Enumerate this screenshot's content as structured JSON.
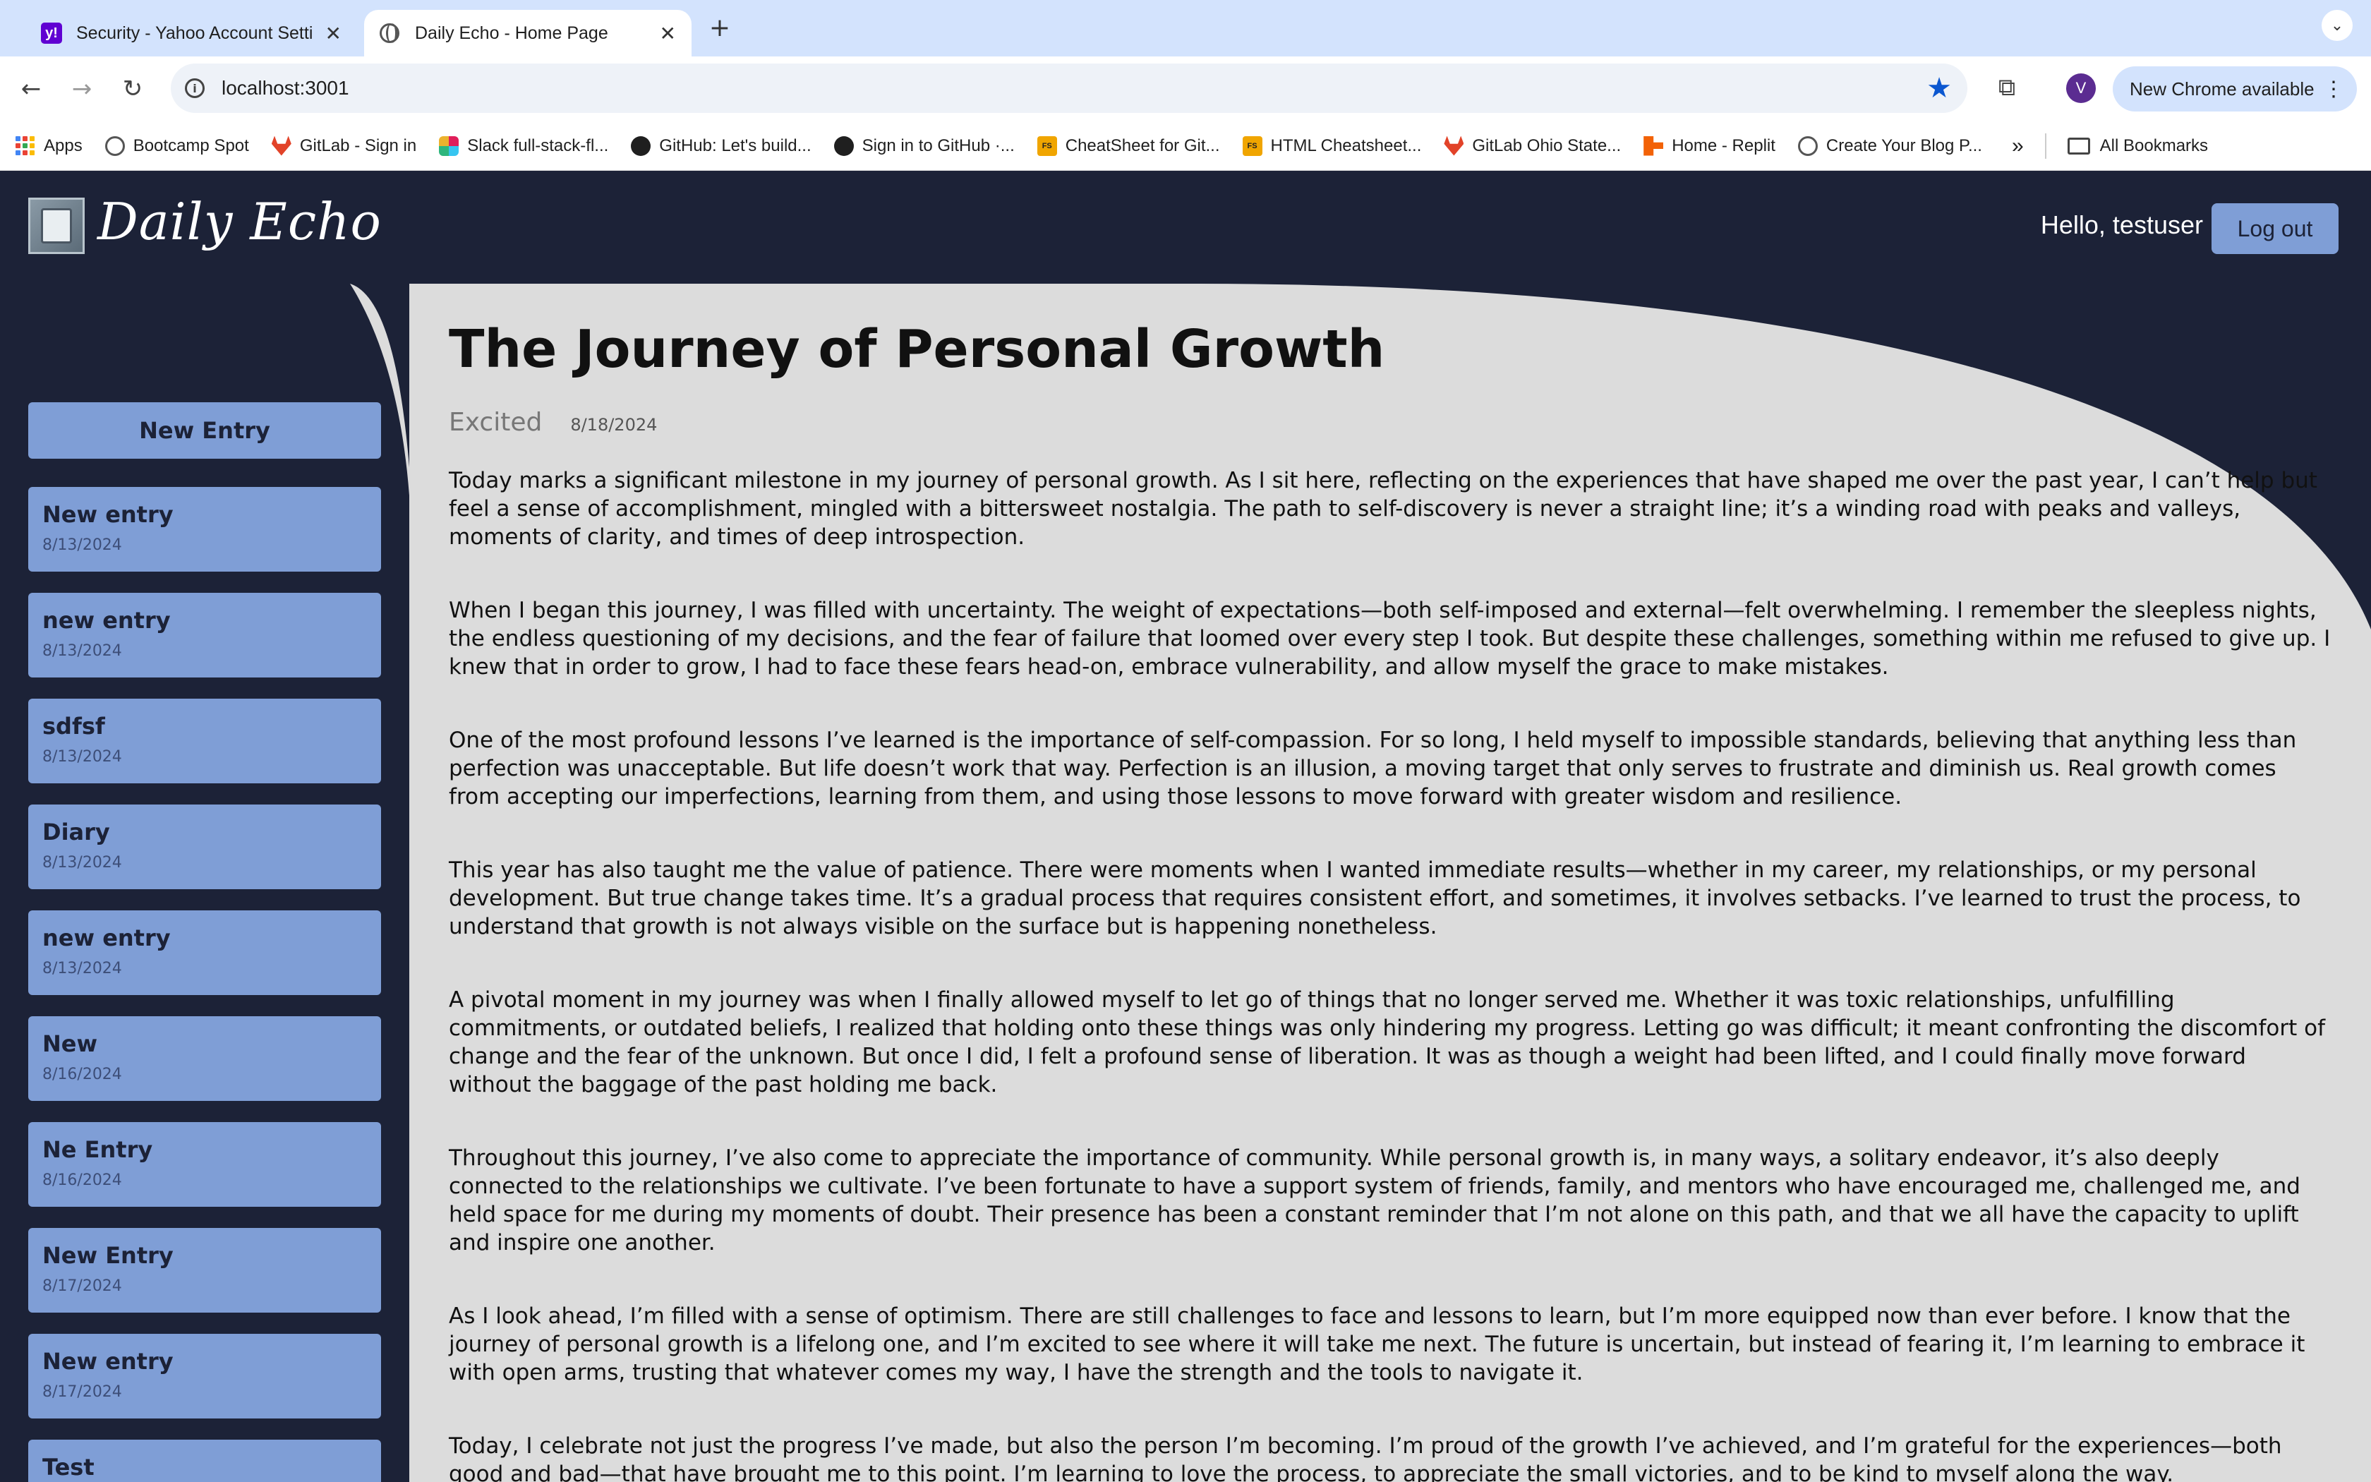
{
  "browser": {
    "tabs": [
      {
        "title": "Security - Yahoo Account Settings",
        "active": false
      },
      {
        "title": "Daily Echo - Home Page",
        "active": true
      }
    ],
    "url": "localhost:3001",
    "profile_initial": "V",
    "update_label": "New Chrome available",
    "bookmarks": [
      {
        "label": "Apps",
        "icon": "apps-grid-icon"
      },
      {
        "label": "Bootcamp Spot",
        "icon": "globe-icon"
      },
      {
        "label": "GitLab - Sign in",
        "icon": "gitlab-icon"
      },
      {
        "label": "Slack full-stack-fl...",
        "icon": "slack-icon"
      },
      {
        "label": "GitHub: Let's build...",
        "icon": "github-icon"
      },
      {
        "label": "Sign in to GitHub ·...",
        "icon": "github-icon"
      },
      {
        "label": "CheatSheet for Git...",
        "icon": "fs-icon"
      },
      {
        "label": "HTML Cheatsheet...",
        "icon": "fs-icon"
      },
      {
        "label": "GitLab Ohio State...",
        "icon": "gitlab-icon"
      },
      {
        "label": "Home - Replit",
        "icon": "replit-icon"
      },
      {
        "label": "Create Your Blog P...",
        "icon": "globe-icon"
      }
    ],
    "all_bookmarks_label": "All Bookmarks"
  },
  "app": {
    "brand": "Daily Echo",
    "greeting": "Hello, testuser",
    "logout_label": "Log out",
    "new_entry_label": "New Entry",
    "entries": [
      {
        "title": "New entry",
        "date": "8/13/2024"
      },
      {
        "title": "new entry",
        "date": "8/13/2024"
      },
      {
        "title": "sdfsf",
        "date": "8/13/2024"
      },
      {
        "title": "Diary",
        "date": "8/13/2024"
      },
      {
        "title": "new entry",
        "date": "8/13/2024"
      },
      {
        "title": "New",
        "date": "8/16/2024"
      },
      {
        "title": "Ne Entry",
        "date": "8/16/2024"
      },
      {
        "title": "New Entry",
        "date": "8/17/2024"
      },
      {
        "title": "New entry",
        "date": "8/17/2024"
      },
      {
        "title": "Test",
        "date": ""
      }
    ],
    "colors": {
      "navy": "#1c2237",
      "accent": "#7f9ed6",
      "panel": "#dcdcdc"
    }
  },
  "post": {
    "title": "The Journey of Personal Growth",
    "mood": "Excited",
    "date": "8/18/2024",
    "paragraphs": [
      "Today marks a significant milestone in my journey of personal growth. As I sit here, reflecting on the experiences that have shaped me over the past year, I can’t help but feel a sense of accomplishment, mingled with a bittersweet nostalgia. The path to self-discovery is never a straight line; it’s a winding road with peaks and valleys, moments of clarity, and times of deep introspection.",
      "When I began this journey, I was filled with uncertainty. The weight of expectations—both self-imposed and external—felt overwhelming. I remember the sleepless nights, the endless questioning of my decisions, and the fear of failure that loomed over every step I took. But despite these challenges, something within me refused to give up. I knew that in order to grow, I had to face these fears head-on, embrace vulnerability, and allow myself the grace to make mistakes.",
      "One of the most profound lessons I’ve learned is the importance of self-compassion. For so long, I held myself to impossible standards, believing that anything less than perfection was unacceptable. But life doesn’t work that way. Perfection is an illusion, a moving target that only serves to frustrate and diminish us. Real growth comes from accepting our imperfections, learning from them, and using those lessons to move forward with greater wisdom and resilience.",
      "This year has also taught me the value of patience. There were moments when I wanted immediate results—whether in my career, my relationships, or my personal development. But true change takes time. It’s a gradual process that requires consistent effort, and sometimes, it involves setbacks. I’ve learned to trust the process, to understand that growth is not always visible on the surface but is happening nonetheless.",
      "A pivotal moment in my journey was when I finally allowed myself to let go of things that no longer served me. Whether it was toxic relationships, unfulfilling commitments, or outdated beliefs, I realized that holding onto these things was only hindering my progress. Letting go was difficult; it meant confronting the discomfort of change and the fear of the unknown. But once I did, I felt a profound sense of liberation. It was as though a weight had been lifted, and I could finally move forward without the baggage of the past holding me back.",
      "Throughout this journey, I’ve also come to appreciate the importance of community. While personal growth is, in many ways, a solitary endeavor, it’s also deeply connected to the relationships we cultivate. I’ve been fortunate to have a support system of friends, family, and mentors who have encouraged me, challenged me, and held space for me during my moments of doubt. Their presence has been a constant reminder that I’m not alone on this path, and that we all have the capacity to uplift and inspire one another.",
      "As I look ahead, I’m filled with a sense of optimism. There are still challenges to face and lessons to learn, but I’m more equipped now than ever before. I know that the journey of personal growth is a lifelong one, and I’m excited to see where it will take me next. The future is uncertain, but instead of fearing it, I’m learning to embrace it with open arms, trusting that whatever comes my way, I have the strength and the tools to navigate it.",
      "Today, I celebrate not just the progress I’ve made, but also the person I’m becoming. I’m proud of the growth I’ve achieved, and I’m grateful for the experiences—both good and bad—that have brought me to this point. I’m learning to love the process, to appreciate the small victories, and to be kind to myself along the way."
    ]
  }
}
